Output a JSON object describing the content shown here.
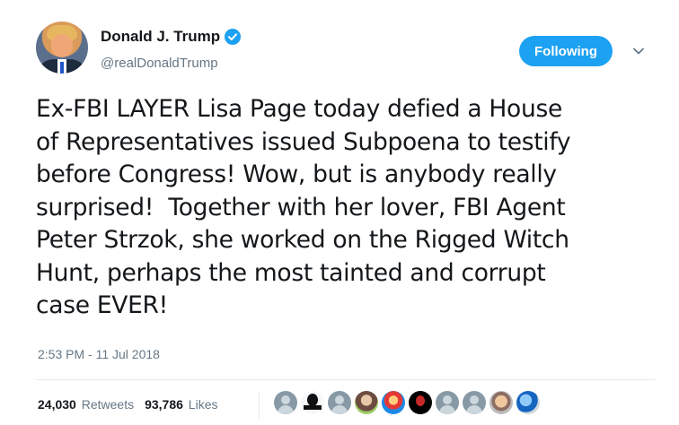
{
  "header": {
    "display_name": "Donald J. Trump",
    "handle": "@realDonaldTrump",
    "follow_label": "Following"
  },
  "tweet": {
    "text": "Ex-FBI LAYER Lisa Page today defied a House\nof Representatives issued Subpoena to testify\nbefore Congress! Wow, but is anybody really\nsurprised!  Together with her lover, FBI Agent\nPeter Strzok, she worked on the Rigged Witch\nHunt, perhaps the most tainted and corrupt\ncase EVER!",
    "timestamp": "2:53 PM - 11 Jul 2018"
  },
  "stats": {
    "retweets_count": "24,030",
    "retweets_label": "Retweets",
    "likes_count": "93,786",
    "likes_label": "Likes"
  },
  "likers": [
    "default-egg-avatar",
    "dark-silhouette-avatar",
    "default-egg-avatar",
    "user-photo-avatar",
    "user-photo-avatar",
    "skull-avatar",
    "default-egg-avatar",
    "default-egg-avatar",
    "user-photo-avatar",
    "user-photo-avatar"
  ],
  "colors": {
    "accent": "#1da1f2",
    "text": "#14171a",
    "secondary": "#657786"
  }
}
